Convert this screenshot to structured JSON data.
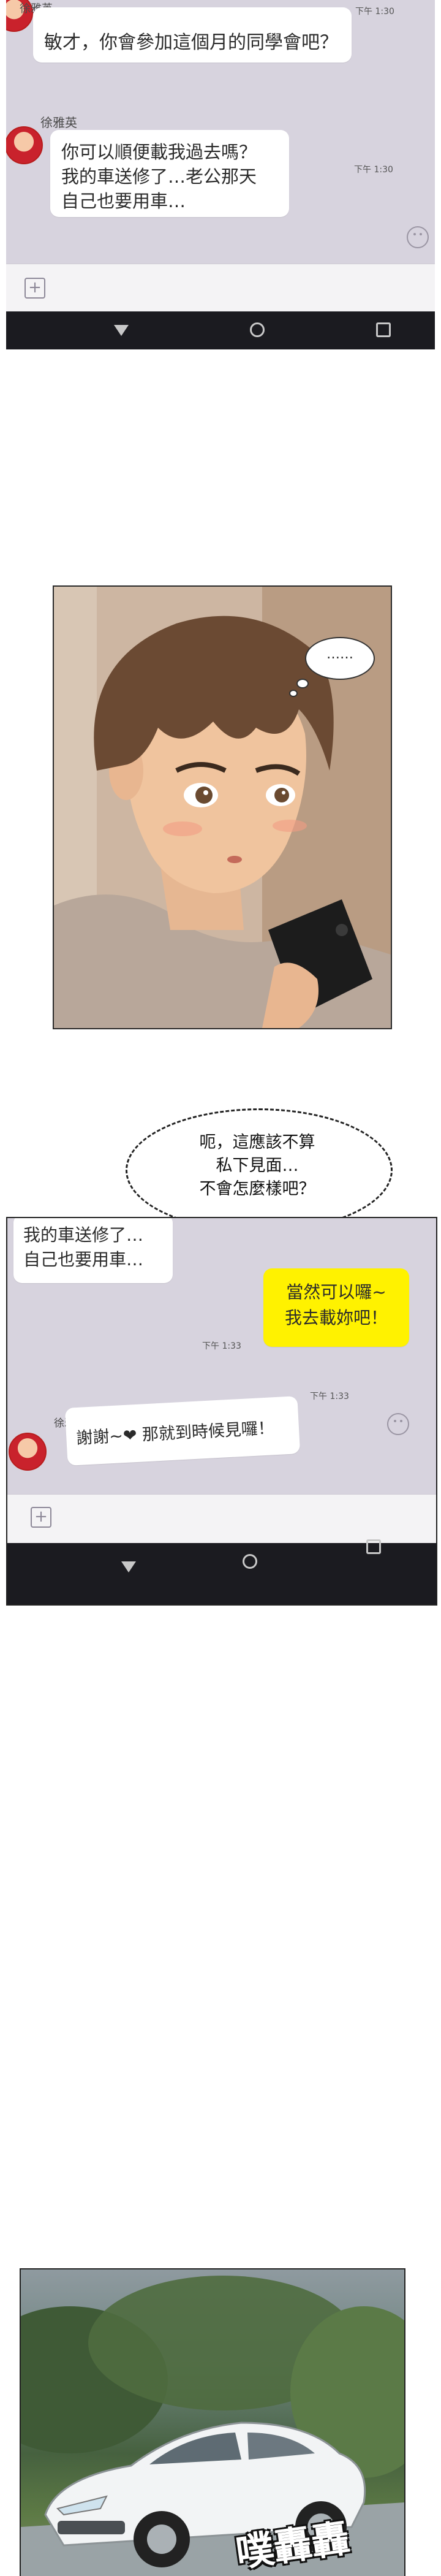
{
  "panel_1": {
    "sender_name": "徐雅英",
    "message_1": "敏才，你會參加這個月的同學會吧？",
    "message_1_time": "下午 1:30",
    "message_2_lines": [
      "你可以順便載我過去嗎？",
      "我的車送修了…老公那天",
      "自己也要用車…"
    ],
    "message_2_time": "下午 1:30"
  },
  "panel_2": {
    "thought": "……"
  },
  "panel_3": {
    "speech_lines": [
      "呃，這應該不算",
      "私下見面…",
      "不會怎麼樣吧？"
    ],
    "partial_message_lines": [
      "我的車送修了…",
      "自己也要用車…"
    ],
    "reply_lines": [
      "當然可以囉~",
      "我去載妳吧！"
    ],
    "reply_time": "下午 1:33",
    "sender_name": "徐雅英",
    "message": "謝謝~❤ 那就到時候見囉！",
    "message_time": "下午 1:33"
  },
  "panel_4": {
    "sfx": "噗轟轟"
  },
  "colors": {
    "chat_bg": "#d7d3de",
    "reply_bubble": "#fff200",
    "avatar_hair": "#c9222c"
  }
}
